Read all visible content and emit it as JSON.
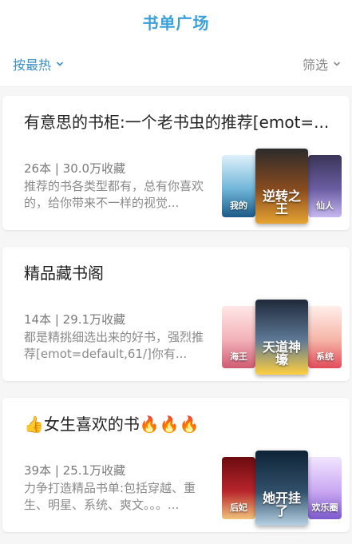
{
  "header": {
    "title": "书单广场"
  },
  "filter": {
    "sort_label": "按最热",
    "filter_label": "筛选"
  },
  "cards": [
    {
      "title": "有意思的书柜:一个老书虫的推荐[emot=...",
      "meta": "26本 | 30.0万收藏",
      "desc": "推荐的书各类型都有，总有你喜欢的，给你带来不一样的视觉...",
      "covers": [
        {
          "text": "我的",
          "colors": [
            "#dff1fb",
            "#6fb5d8",
            "#1b5b87"
          ]
        },
        {
          "text": "逆转之王",
          "colors": [
            "#2c2b2b",
            "#8a4c1e",
            "#e7a431"
          ]
        },
        {
          "text": "仙人",
          "colors": [
            "#3a3558",
            "#6b5ea3",
            "#c6b8f0"
          ]
        }
      ]
    },
    {
      "title": "精品藏书阁",
      "meta": "14本 | 29.1万收藏",
      "desc": "都是精挑细选出来的好书，强烈推荐[emot=default,61/]你有...",
      "covers": [
        {
          "text": "海王",
          "colors": [
            "#ffe7e7",
            "#f2b1b7",
            "#cf5b70"
          ]
        },
        {
          "text": "天道神壕",
          "colors": [
            "#1f2a3b",
            "#5f7a96",
            "#ffcf3e"
          ]
        },
        {
          "text": "系统",
          "colors": [
            "#ffeeea",
            "#f5b5a6",
            "#e24a59"
          ]
        }
      ]
    },
    {
      "title": "👍女生喜欢的书🔥🔥🔥",
      "meta": "39本 | 25.1万收藏",
      "desc": "力争打造精品书单:包括穿越、重生、明星、系统、爽文。。。...",
      "covers": [
        {
          "text": "后妃",
          "colors": [
            "#6b0b0f",
            "#b7252c",
            "#f1c27a"
          ]
        },
        {
          "text": "她开挂了",
          "colors": [
            "#0e2336",
            "#31506a",
            "#b7d1e4"
          ]
        },
        {
          "text": "欢乐圈",
          "colors": [
            "#f1e5ff",
            "#caa8f2",
            "#7c5acb"
          ]
        }
      ]
    }
  ]
}
